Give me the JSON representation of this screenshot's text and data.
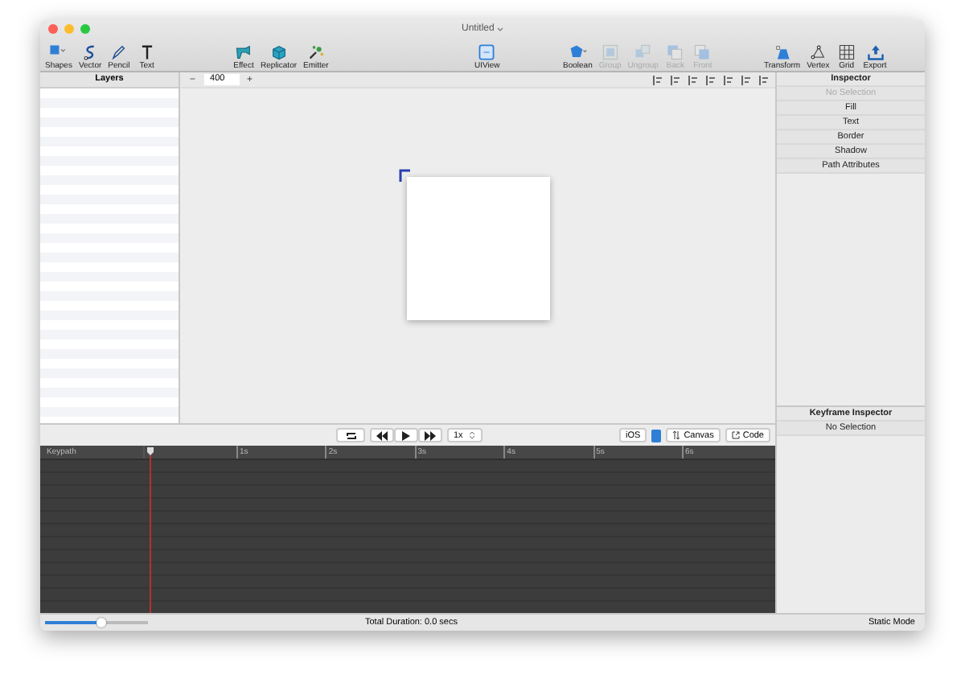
{
  "window": {
    "title": "Untitled"
  },
  "toolbar": {
    "items": [
      {
        "label": "Shapes",
        "kind": "shapes",
        "disabled": false
      },
      {
        "label": "Vector",
        "kind": "vector",
        "disabled": false
      },
      {
        "label": "Pencil",
        "kind": "pencil",
        "disabled": false
      },
      {
        "label": "Text",
        "kind": "text",
        "disabled": false
      },
      {
        "label": "Effect",
        "kind": "effect",
        "disabled": false
      },
      {
        "label": "Replicator",
        "kind": "replicator",
        "disabled": false
      },
      {
        "label": "Emitter",
        "kind": "emitter",
        "disabled": false
      },
      {
        "label": "UIView",
        "kind": "uiview",
        "disabled": false
      },
      {
        "label": "Boolean",
        "kind": "boolean",
        "disabled": false
      },
      {
        "label": "Group",
        "kind": "group",
        "disabled": true
      },
      {
        "label": "Ungroup",
        "kind": "ungroup",
        "disabled": true
      },
      {
        "label": "Back",
        "kind": "back",
        "disabled": true
      },
      {
        "label": "Front",
        "kind": "front",
        "disabled": true
      },
      {
        "label": "Transform",
        "kind": "transform",
        "disabled": false
      },
      {
        "label": "Vertex",
        "kind": "vertex",
        "disabled": false
      },
      {
        "label": "Grid",
        "kind": "grid",
        "disabled": false
      },
      {
        "label": "Export",
        "kind": "export",
        "disabled": false
      }
    ]
  },
  "layers": {
    "title": "Layers"
  },
  "canvas": {
    "zoom_out": "−",
    "zoom": "400",
    "zoom_in": "+"
  },
  "inspector": {
    "title": "Inspector",
    "status": "No Selection",
    "sections": [
      "Fill",
      "Text",
      "Border",
      "Shadow",
      "Path Attributes"
    ]
  },
  "keyframe_inspector": {
    "title": "Keyframe Inspector",
    "status": "No Selection"
  },
  "playback": {
    "speed": "1x",
    "platform": "iOS",
    "canvas_button": "Canvas",
    "code_button": "Code"
  },
  "timeline": {
    "header": "Keypath",
    "ticks": [
      "1s",
      "2s",
      "3s",
      "4s",
      "5s",
      "6s"
    ]
  },
  "status_bar": {
    "zoom_slider": {
      "level": 0.54
    },
    "duration": "Total Duration: 0.0 secs",
    "mode": "Static Mode"
  }
}
